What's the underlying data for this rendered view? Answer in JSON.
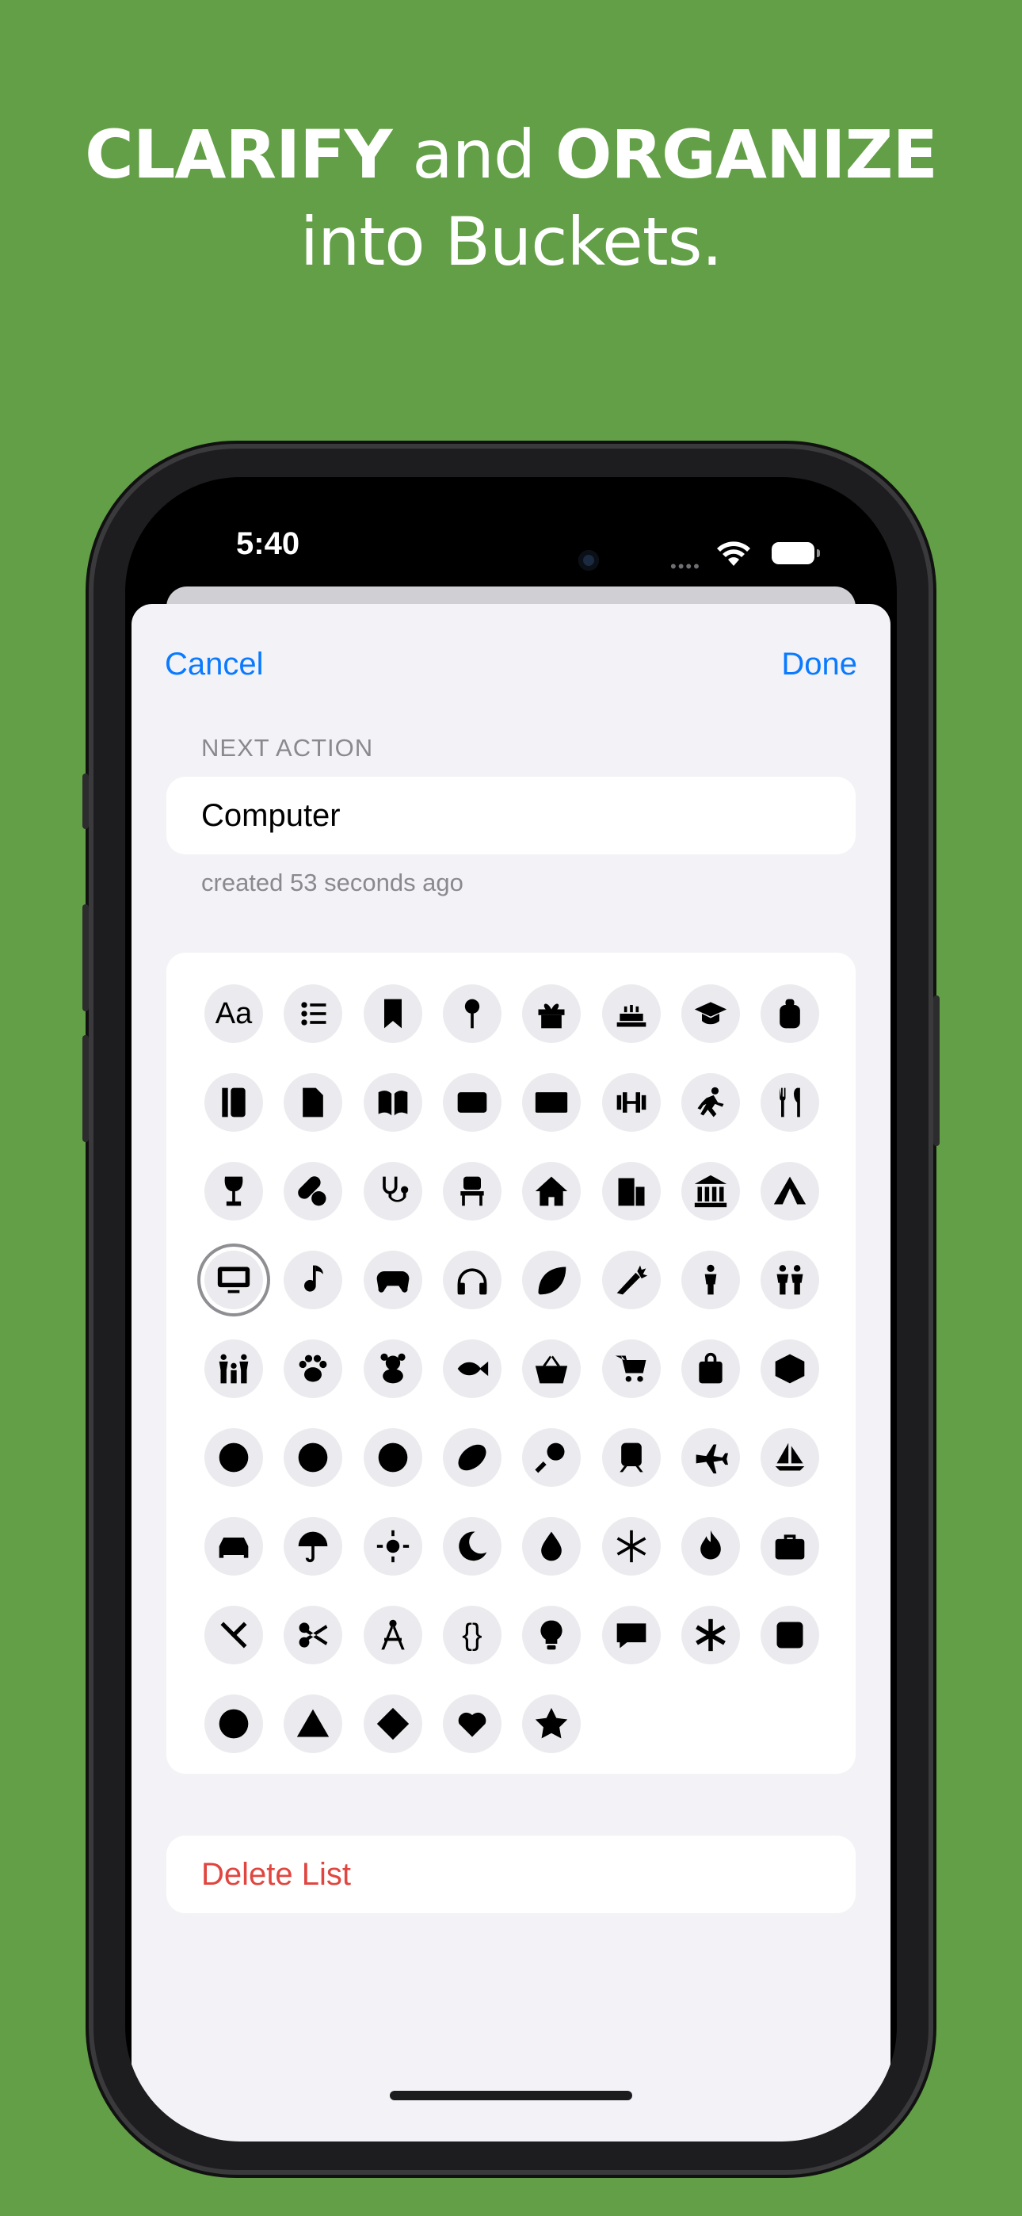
{
  "headline": {
    "bold1": "CLARIFY",
    "mid": " and ",
    "bold2": "ORGANIZE",
    "line2": "into Buckets."
  },
  "status": {
    "time": "5:40"
  },
  "nav": {
    "cancel": "Cancel",
    "done": "Done"
  },
  "form": {
    "section_label": "NEXT ACTION",
    "name_value": "Computer",
    "created": "created 53 seconds ago"
  },
  "delete_label": "Delete List",
  "icons": [
    [
      "text-icon",
      "list-icon",
      "bookmark-icon",
      "pin-icon",
      "gift-icon",
      "cake-icon",
      "graduation-cap-icon",
      "backpack-icon"
    ],
    [
      "ruler-icon",
      "document-icon",
      "book-icon",
      "credit-card-icon",
      "banknote-icon",
      "dumbbell-icon",
      "running-icon",
      "fork-knife-icon"
    ],
    [
      "wine-glass-icon",
      "pills-icon",
      "stethoscope-icon",
      "chair-icon",
      "house-icon",
      "building-icon",
      "bank-icon",
      "tent-icon"
    ],
    [
      "computer-icon",
      "music-note-icon",
      "gamepad-icon",
      "headphones-icon",
      "leaf-icon",
      "carrot-icon",
      "person-icon",
      "two-people-icon"
    ],
    [
      "family-icon",
      "paw-icon",
      "teddy-bear-icon",
      "fish-icon",
      "basket-icon",
      "cart-icon",
      "bag-icon",
      "box-icon"
    ],
    [
      "soccer-ball-icon",
      "baseball-icon",
      "basketball-icon",
      "football-icon",
      "tennis-racket-icon",
      "train-icon",
      "airplane-icon",
      "sailboat-icon"
    ],
    [
      "car-icon",
      "umbrella-icon",
      "sun-icon",
      "moon-icon",
      "drop-icon",
      "snowflake-icon",
      "flame-icon",
      "briefcase-icon"
    ],
    [
      "tools-icon",
      "scissors-icon",
      "compass-icon",
      "braces-icon",
      "lightbulb-icon",
      "speech-bubble-icon",
      "asterisk-icon",
      "square-icon"
    ],
    [
      "circle-icon",
      "triangle-icon",
      "diamond-icon",
      "heart-icon",
      "star-icon"
    ]
  ],
  "icon_text": {
    "aa": "Aa",
    "braces": "{}"
  },
  "selected_icon": "computer-icon",
  "colors": {
    "background": "#629f46",
    "accent": "#0a7aff",
    "destructive": "#e0463f"
  }
}
